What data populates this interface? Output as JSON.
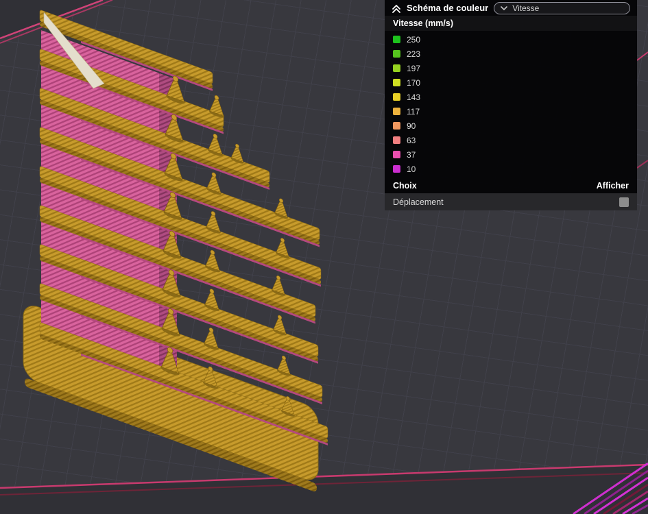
{
  "legend_panel": {
    "title": "Schéma de couleur",
    "scheme_dropdown": {
      "value": "Vitesse"
    },
    "section_title": "Vitesse (mm/s)",
    "items": [
      {
        "label": "250",
        "color": "#1dc21d"
      },
      {
        "label": "223",
        "color": "#56c41e"
      },
      {
        "label": "197",
        "color": "#96d220"
      },
      {
        "label": "170",
        "color": "#cfdf22"
      },
      {
        "label": "143",
        "color": "#e8d026"
      },
      {
        "label": "117",
        "color": "#ecb23d"
      },
      {
        "label": "90",
        "color": "#f0975f"
      },
      {
        "label": "63",
        "color": "#f27f80"
      },
      {
        "label": "37",
        "color": "#e94fae"
      },
      {
        "label": "10",
        "color": "#cb2ed0"
      }
    ],
    "options_header": {
      "choice_label": "Choix",
      "show_label": "Afficher"
    },
    "option_rows": [
      {
        "label": "Déplacement",
        "checked": false
      }
    ]
  },
  "scene": {
    "model": "speed-tower-gcode-preview",
    "colors": {
      "viewport_background": "#38383e",
      "grid_line": "#41414a",
      "model_top_surface": "#c79b2c",
      "model_walls": "#d9639d",
      "bed_outline": "#c83a6e",
      "purge_lines": "#cf2fcf"
    }
  }
}
